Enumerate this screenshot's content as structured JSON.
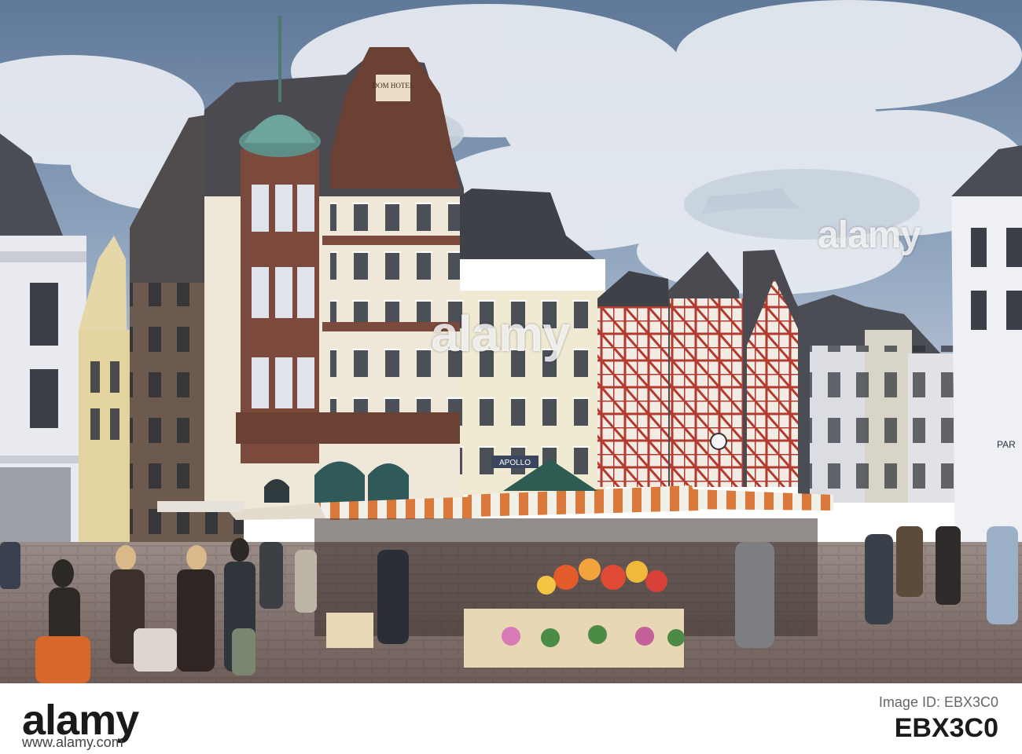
{
  "scene": {
    "description_colors": {
      "sky": "#6f86a4",
      "cloud": "#e9edf3",
      "cobble": "#8b7b77",
      "timber_red": "#b33a2e",
      "awning_orange": "#d97a3c"
    },
    "signs": {
      "hotel_sign": "DOM HOTEL",
      "shop_sign": "APOLLO",
      "right_sign": "PAR"
    }
  },
  "watermark": {
    "center": "alamy",
    "top_right": "alamy"
  },
  "strip": {
    "logo": "alamy",
    "id_label": "Image ID: EBX3C0",
    "id": "EBX3C0",
    "url": "www.alamy.com"
  }
}
